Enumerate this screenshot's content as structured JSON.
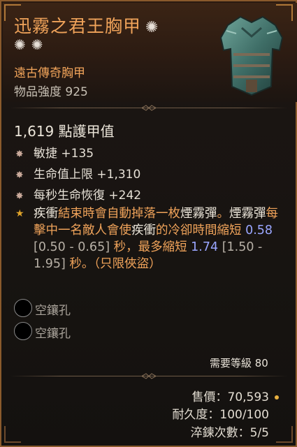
{
  "item": {
    "name": "迅霧之君王胸甲",
    "type": "遠古傳奇胸甲",
    "power": "物品強度 925"
  },
  "armor": "1,619 點護甲值",
  "stats": [
    "敏捷 +135",
    "生命值上限 +1,310",
    "每秒生命恢復 +242"
  ],
  "aspect": {
    "p1": "疾衝",
    "p2": "結束時會自動掉落一枚",
    "p3": "煙霧彈",
    "p4": "。",
    "p5": "煙霧彈",
    "p6": "每擊中一名敵人會使",
    "p7": "疾衝",
    "p8": "的冷卻時間縮短 ",
    "p9": "0.58",
    "p10": " [0.50 - 0.65] ",
    "p11": "秒，最多縮短 ",
    "p12": "1.74",
    "p13": " [1.50 - 1.95] ",
    "p14": "秒。（只限俠盜）"
  },
  "sockets": [
    "空鑲孔",
    "空鑲孔"
  ],
  "requirement": "需要等級 80",
  "sell": "售價：70,593",
  "durability": "耐久度：100/100",
  "temper": "淬鍊次數：5/5",
  "colors": {
    "legendary": "#f0a35a",
    "value": "#9aa6ff",
    "frame": "#8a5a2c"
  },
  "icons": {
    "star": "star-icon",
    "bullet": "bullet-icon",
    "aspect_bullet": "aspect-star-icon"
  }
}
